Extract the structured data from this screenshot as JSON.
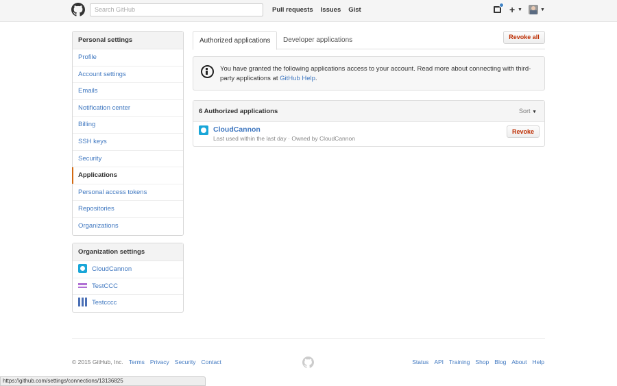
{
  "header": {
    "search_placeholder": "Search GitHub",
    "nav": [
      "Pull requests",
      "Issues",
      "Gist"
    ],
    "icons": [
      "github-logo",
      "notifications",
      "plus",
      "avatar"
    ]
  },
  "sidebar": {
    "personal": {
      "heading": "Personal settings",
      "items": [
        {
          "label": "Profile"
        },
        {
          "label": "Account settings"
        },
        {
          "label": "Emails"
        },
        {
          "label": "Notification center"
        },
        {
          "label": "Billing"
        },
        {
          "label": "SSH keys"
        },
        {
          "label": "Security"
        },
        {
          "label": "Applications",
          "selected": true
        },
        {
          "label": "Personal access tokens"
        },
        {
          "label": "Repositories"
        },
        {
          "label": "Organizations"
        }
      ]
    },
    "organizations": {
      "heading": "Organization settings",
      "items": [
        {
          "label": "CloudCannon"
        },
        {
          "label": "TestCCC"
        },
        {
          "label": "Testcccc"
        }
      ]
    }
  },
  "tabs": {
    "authorized": "Authorized applications",
    "developer": "Developer applications"
  },
  "revoke_all_label": "Revoke all",
  "flash": {
    "text": "You have granted the following applications access to your account. Read more about connecting with third-party applications at ",
    "link": "GitHub Help",
    "suffix": "."
  },
  "apps": {
    "title": "6 Authorized applications",
    "sort_label": "Sort",
    "items": [
      {
        "name": "CloudCannon",
        "meta": "Last used within the last day · Owned by CloudCannon",
        "revoke_label": "Revoke"
      }
    ]
  },
  "footer": {
    "copyright": "© 2015 GitHub, Inc.",
    "left_links": [
      "Terms",
      "Privacy",
      "Security",
      "Contact"
    ],
    "right_links": [
      "Status",
      "API",
      "Training",
      "Shop",
      "Blog",
      "About",
      "Help"
    ]
  },
  "statusbar": "https://github.com/settings/connections/13136825",
  "colors": {
    "link": "#4078c0",
    "danger": "#bd2c00",
    "selected_accent": "#d26911",
    "cloudcannon": "#19a6d8"
  }
}
